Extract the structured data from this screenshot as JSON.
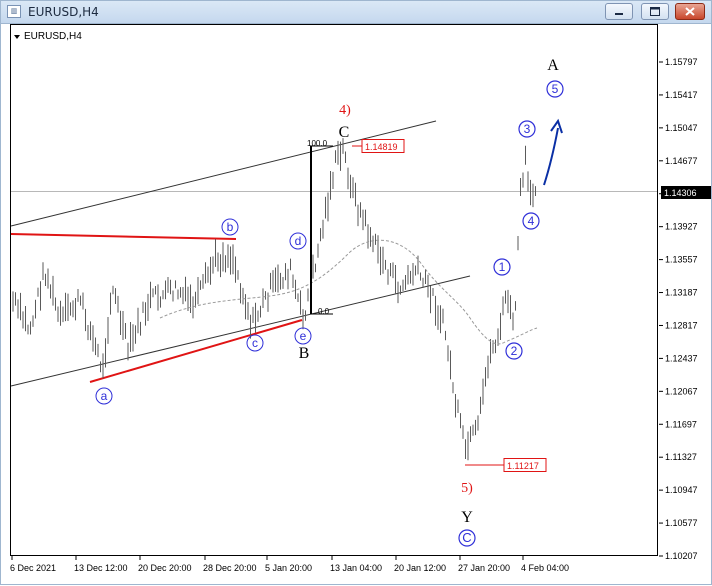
{
  "window": {
    "title": "EURUSD,H4",
    "icon_name": "chart-window-icon"
  },
  "chart_header": {
    "label": "EURUSD,H4",
    "menu_icon": "triangle-down-icon"
  },
  "price_axis": {
    "ticks": [
      "1.15797",
      "1.15417",
      "1.15047",
      "1.14677",
      "1.14306",
      "1.13927",
      "1.13557",
      "1.13187",
      "1.12817",
      "1.12437",
      "1.12067",
      "1.11697",
      "1.11327",
      "1.10947",
      "1.10577",
      "1.10207"
    ],
    "current_price": "1.14306"
  },
  "time_axis": {
    "ticks": [
      "6 Dec 2021",
      "13 Dec 12:00",
      "20 Dec 20:00",
      "28 Dec 20:00",
      "5 Jan 20:00",
      "13 Jan 04:00",
      "20 Jan 12:00",
      "27 Jan 20:00",
      "4 Feb 04:00"
    ]
  },
  "annotations": {
    "wave_a": "a",
    "wave_b": "b",
    "wave_c": "c",
    "wave_d": "d",
    "wave_e": "e",
    "big_B": "B",
    "big_C": "C",
    "big_A": "A",
    "big_Y": "Y",
    "big_circle_C": "C",
    "wave4": "4)",
    "wave5": "5)",
    "impulse_1": "1",
    "impulse_2": "2",
    "impulse_3": "3",
    "impulse_4": "4",
    "impulse_5": "5",
    "fib_100": "100.0",
    "fib_0": "0.0",
    "high_price": "1.14819",
    "low_price": "1.11217"
  },
  "colors": {
    "wave_blue": "#2f2fd8",
    "red": "#e01414",
    "arrow_blue": "#0a2fa5",
    "bars": "#5a5a5a"
  }
}
